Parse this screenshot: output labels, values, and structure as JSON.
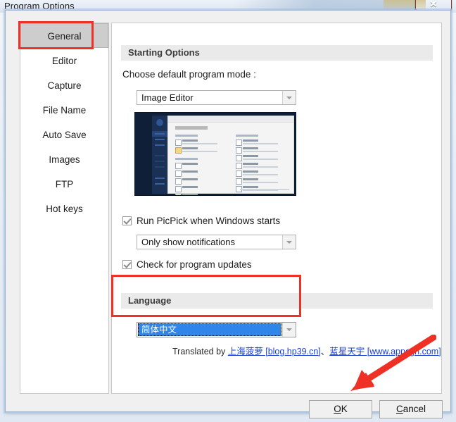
{
  "window": {
    "title": "Program Options",
    "close_icon": "close-icon",
    "close_glyph": "✕"
  },
  "sidebar": {
    "items": [
      {
        "label": "General",
        "selected": true
      },
      {
        "label": "Editor",
        "selected": false
      },
      {
        "label": "Capture",
        "selected": false
      },
      {
        "label": "File Name",
        "selected": false
      },
      {
        "label": "Auto Save",
        "selected": false
      },
      {
        "label": "Images",
        "selected": false
      },
      {
        "label": "FTP",
        "selected": false
      },
      {
        "label": "Hot keys",
        "selected": false
      }
    ]
  },
  "content": {
    "starting_options": {
      "header": "Starting Options",
      "mode_label": "Choose default program mode :",
      "mode_value": "Image Editor",
      "startup_checkbox": {
        "label": "Run PicPick when Windows starts",
        "checked": true
      },
      "startup_notification_value": "Only show notifications",
      "updates_checkbox": {
        "label": "Check for program updates",
        "checked": true
      }
    },
    "language": {
      "header": "Language",
      "selected_value": "简体中文",
      "translated_prefix": "Translated by ",
      "translator_1": "上海菠萝 [blog.hp39.cn]",
      "translator_separator": "、",
      "translator_2": "蓝星天宇 [www.appcgn.com]"
    }
  },
  "footer": {
    "ok_accel": "O",
    "ok_rest": "K",
    "cancel_accel": "C",
    "cancel_rest": "ancel"
  },
  "annotations": {
    "highlight_color": "#ee3124",
    "boxes": [
      "general-nav-item",
      "language-section"
    ],
    "arrow_target": "ok-button"
  },
  "colors": {
    "selection_blue": "#2f86e8",
    "link_blue": "#1a3fd0",
    "annotation_red": "#ee3124",
    "section_header_bg": "#eaeaea"
  }
}
